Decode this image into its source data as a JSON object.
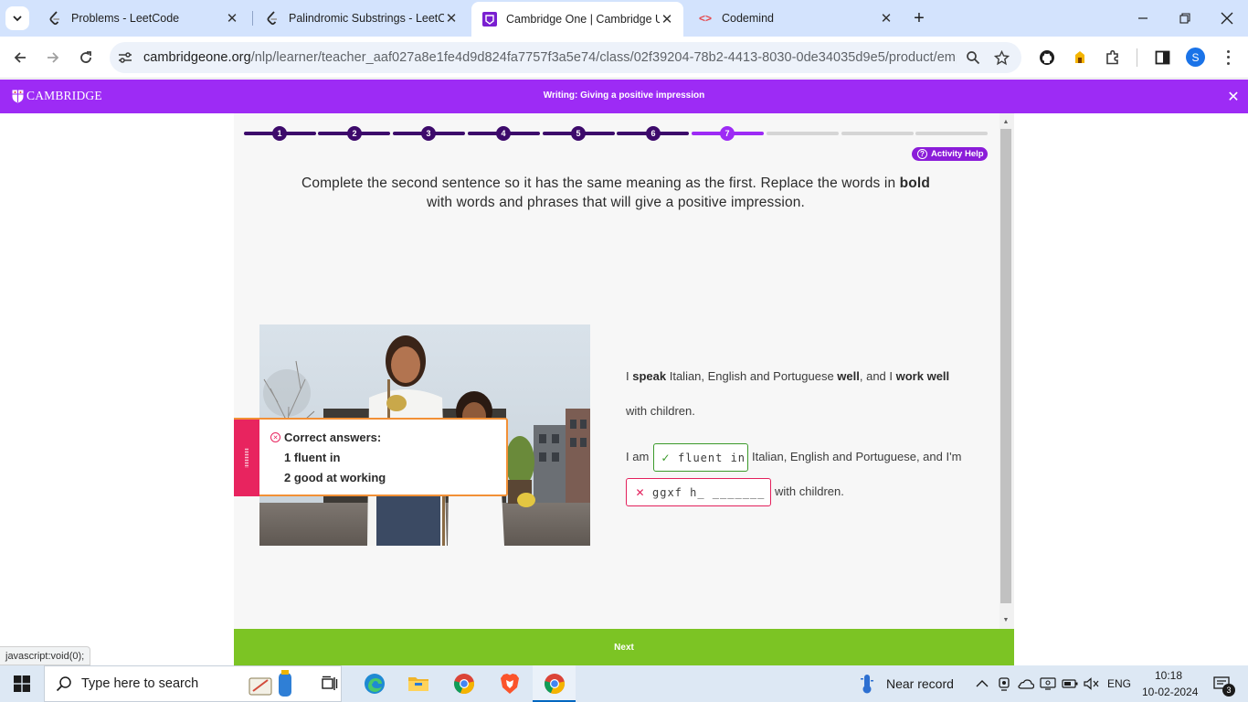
{
  "browser": {
    "tabs": [
      {
        "title": "Problems - LeetCode",
        "icon": "leetcode-icon",
        "active": false
      },
      {
        "title": "Palindromic Substrings - LeetCode",
        "icon": "leetcode-icon",
        "active": false
      },
      {
        "title": "Cambridge One | Cambridge University Press",
        "icon": "cambridge-one-icon",
        "active": true
      },
      {
        "title": "Codemind",
        "icon": "code-brackets-icon",
        "active": false
      }
    ],
    "url_host": "cambridgeone.org",
    "url_path": "/nlp/learner/teacher_aaf027a8e1fe4d9d824fa7757f3a5e74/class/02f39204-78b2-4413-8030-0de34035d9e5/product/empbe...",
    "profile_initial": "S",
    "status_url": "javascript:void(0);"
  },
  "app": {
    "logo_text": "CAMBRIDGE",
    "activity_title": "Writing: Giving a positive impression",
    "brand_color": "#9d2bf5",
    "progress": {
      "steps": [
        "1",
        "2",
        "3",
        "4",
        "5",
        "6",
        "7"
      ],
      "total_segments": 10,
      "current_step": 7
    },
    "help_label": "Activity Help",
    "instruction": {
      "before_bold": "Complete the second sentence so it has the same meaning as the first. Replace the words in ",
      "bold": "bold",
      "after_bold": "with words and phrases that will give a positive impression."
    },
    "feedback": {
      "title": "Correct answers:",
      "answers": [
        "1 fluent in",
        "2 good at working"
      ]
    },
    "original_sentence": {
      "t1": "I ",
      "b1": "speak",
      "t2": " Italian, English and Portuguese ",
      "b2": "well",
      "t3": ", and I ",
      "b3": "work well",
      "line2": "with children."
    },
    "rewrite": {
      "prefix": "I am",
      "answer1": "fluent in",
      "answer1_status": "correct",
      "middle": "Italian, English and Portuguese, and I'm",
      "answer2": "ggxf h_ _______",
      "answer2_status": "incorrect",
      "suffix": "with children."
    },
    "next_label": "Next"
  },
  "taskbar": {
    "search_placeholder": "Type here to search",
    "weather": "Near record",
    "language": "ENG",
    "time": "10:18",
    "date": "10-02-2024",
    "notification_count": "3"
  }
}
